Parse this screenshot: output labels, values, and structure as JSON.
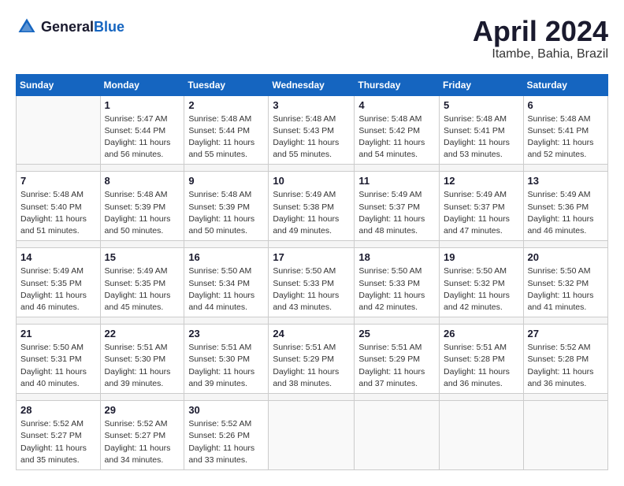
{
  "header": {
    "logo_general": "General",
    "logo_blue": "Blue",
    "month": "April 2024",
    "location": "Itambe, Bahia, Brazil"
  },
  "days_of_week": [
    "Sunday",
    "Monday",
    "Tuesday",
    "Wednesday",
    "Thursday",
    "Friday",
    "Saturday"
  ],
  "weeks": [
    {
      "days": [
        {
          "number": "",
          "info": ""
        },
        {
          "number": "1",
          "info": "Sunrise: 5:47 AM\nSunset: 5:44 PM\nDaylight: 11 hours\nand 56 minutes."
        },
        {
          "number": "2",
          "info": "Sunrise: 5:48 AM\nSunset: 5:44 PM\nDaylight: 11 hours\nand 55 minutes."
        },
        {
          "number": "3",
          "info": "Sunrise: 5:48 AM\nSunset: 5:43 PM\nDaylight: 11 hours\nand 55 minutes."
        },
        {
          "number": "4",
          "info": "Sunrise: 5:48 AM\nSunset: 5:42 PM\nDaylight: 11 hours\nand 54 minutes."
        },
        {
          "number": "5",
          "info": "Sunrise: 5:48 AM\nSunset: 5:41 PM\nDaylight: 11 hours\nand 53 minutes."
        },
        {
          "number": "6",
          "info": "Sunrise: 5:48 AM\nSunset: 5:41 PM\nDaylight: 11 hours\nand 52 minutes."
        }
      ]
    },
    {
      "days": [
        {
          "number": "7",
          "info": "Sunrise: 5:48 AM\nSunset: 5:40 PM\nDaylight: 11 hours\nand 51 minutes."
        },
        {
          "number": "8",
          "info": "Sunrise: 5:48 AM\nSunset: 5:39 PM\nDaylight: 11 hours\nand 50 minutes."
        },
        {
          "number": "9",
          "info": "Sunrise: 5:48 AM\nSunset: 5:39 PM\nDaylight: 11 hours\nand 50 minutes."
        },
        {
          "number": "10",
          "info": "Sunrise: 5:49 AM\nSunset: 5:38 PM\nDaylight: 11 hours\nand 49 minutes."
        },
        {
          "number": "11",
          "info": "Sunrise: 5:49 AM\nSunset: 5:37 PM\nDaylight: 11 hours\nand 48 minutes."
        },
        {
          "number": "12",
          "info": "Sunrise: 5:49 AM\nSunset: 5:37 PM\nDaylight: 11 hours\nand 47 minutes."
        },
        {
          "number": "13",
          "info": "Sunrise: 5:49 AM\nSunset: 5:36 PM\nDaylight: 11 hours\nand 46 minutes."
        }
      ]
    },
    {
      "days": [
        {
          "number": "14",
          "info": "Sunrise: 5:49 AM\nSunset: 5:35 PM\nDaylight: 11 hours\nand 46 minutes."
        },
        {
          "number": "15",
          "info": "Sunrise: 5:49 AM\nSunset: 5:35 PM\nDaylight: 11 hours\nand 45 minutes."
        },
        {
          "number": "16",
          "info": "Sunrise: 5:50 AM\nSunset: 5:34 PM\nDaylight: 11 hours\nand 44 minutes."
        },
        {
          "number": "17",
          "info": "Sunrise: 5:50 AM\nSunset: 5:33 PM\nDaylight: 11 hours\nand 43 minutes."
        },
        {
          "number": "18",
          "info": "Sunrise: 5:50 AM\nSunset: 5:33 PM\nDaylight: 11 hours\nand 42 minutes."
        },
        {
          "number": "19",
          "info": "Sunrise: 5:50 AM\nSunset: 5:32 PM\nDaylight: 11 hours\nand 42 minutes."
        },
        {
          "number": "20",
          "info": "Sunrise: 5:50 AM\nSunset: 5:32 PM\nDaylight: 11 hours\nand 41 minutes."
        }
      ]
    },
    {
      "days": [
        {
          "number": "21",
          "info": "Sunrise: 5:50 AM\nSunset: 5:31 PM\nDaylight: 11 hours\nand 40 minutes."
        },
        {
          "number": "22",
          "info": "Sunrise: 5:51 AM\nSunset: 5:30 PM\nDaylight: 11 hours\nand 39 minutes."
        },
        {
          "number": "23",
          "info": "Sunrise: 5:51 AM\nSunset: 5:30 PM\nDaylight: 11 hours\nand 39 minutes."
        },
        {
          "number": "24",
          "info": "Sunrise: 5:51 AM\nSunset: 5:29 PM\nDaylight: 11 hours\nand 38 minutes."
        },
        {
          "number": "25",
          "info": "Sunrise: 5:51 AM\nSunset: 5:29 PM\nDaylight: 11 hours\nand 37 minutes."
        },
        {
          "number": "26",
          "info": "Sunrise: 5:51 AM\nSunset: 5:28 PM\nDaylight: 11 hours\nand 36 minutes."
        },
        {
          "number": "27",
          "info": "Sunrise: 5:52 AM\nSunset: 5:28 PM\nDaylight: 11 hours\nand 36 minutes."
        }
      ]
    },
    {
      "days": [
        {
          "number": "28",
          "info": "Sunrise: 5:52 AM\nSunset: 5:27 PM\nDaylight: 11 hours\nand 35 minutes."
        },
        {
          "number": "29",
          "info": "Sunrise: 5:52 AM\nSunset: 5:27 PM\nDaylight: 11 hours\nand 34 minutes."
        },
        {
          "number": "30",
          "info": "Sunrise: 5:52 AM\nSunset: 5:26 PM\nDaylight: 11 hours\nand 33 minutes."
        },
        {
          "number": "",
          "info": ""
        },
        {
          "number": "",
          "info": ""
        },
        {
          "number": "",
          "info": ""
        },
        {
          "number": "",
          "info": ""
        }
      ]
    }
  ]
}
